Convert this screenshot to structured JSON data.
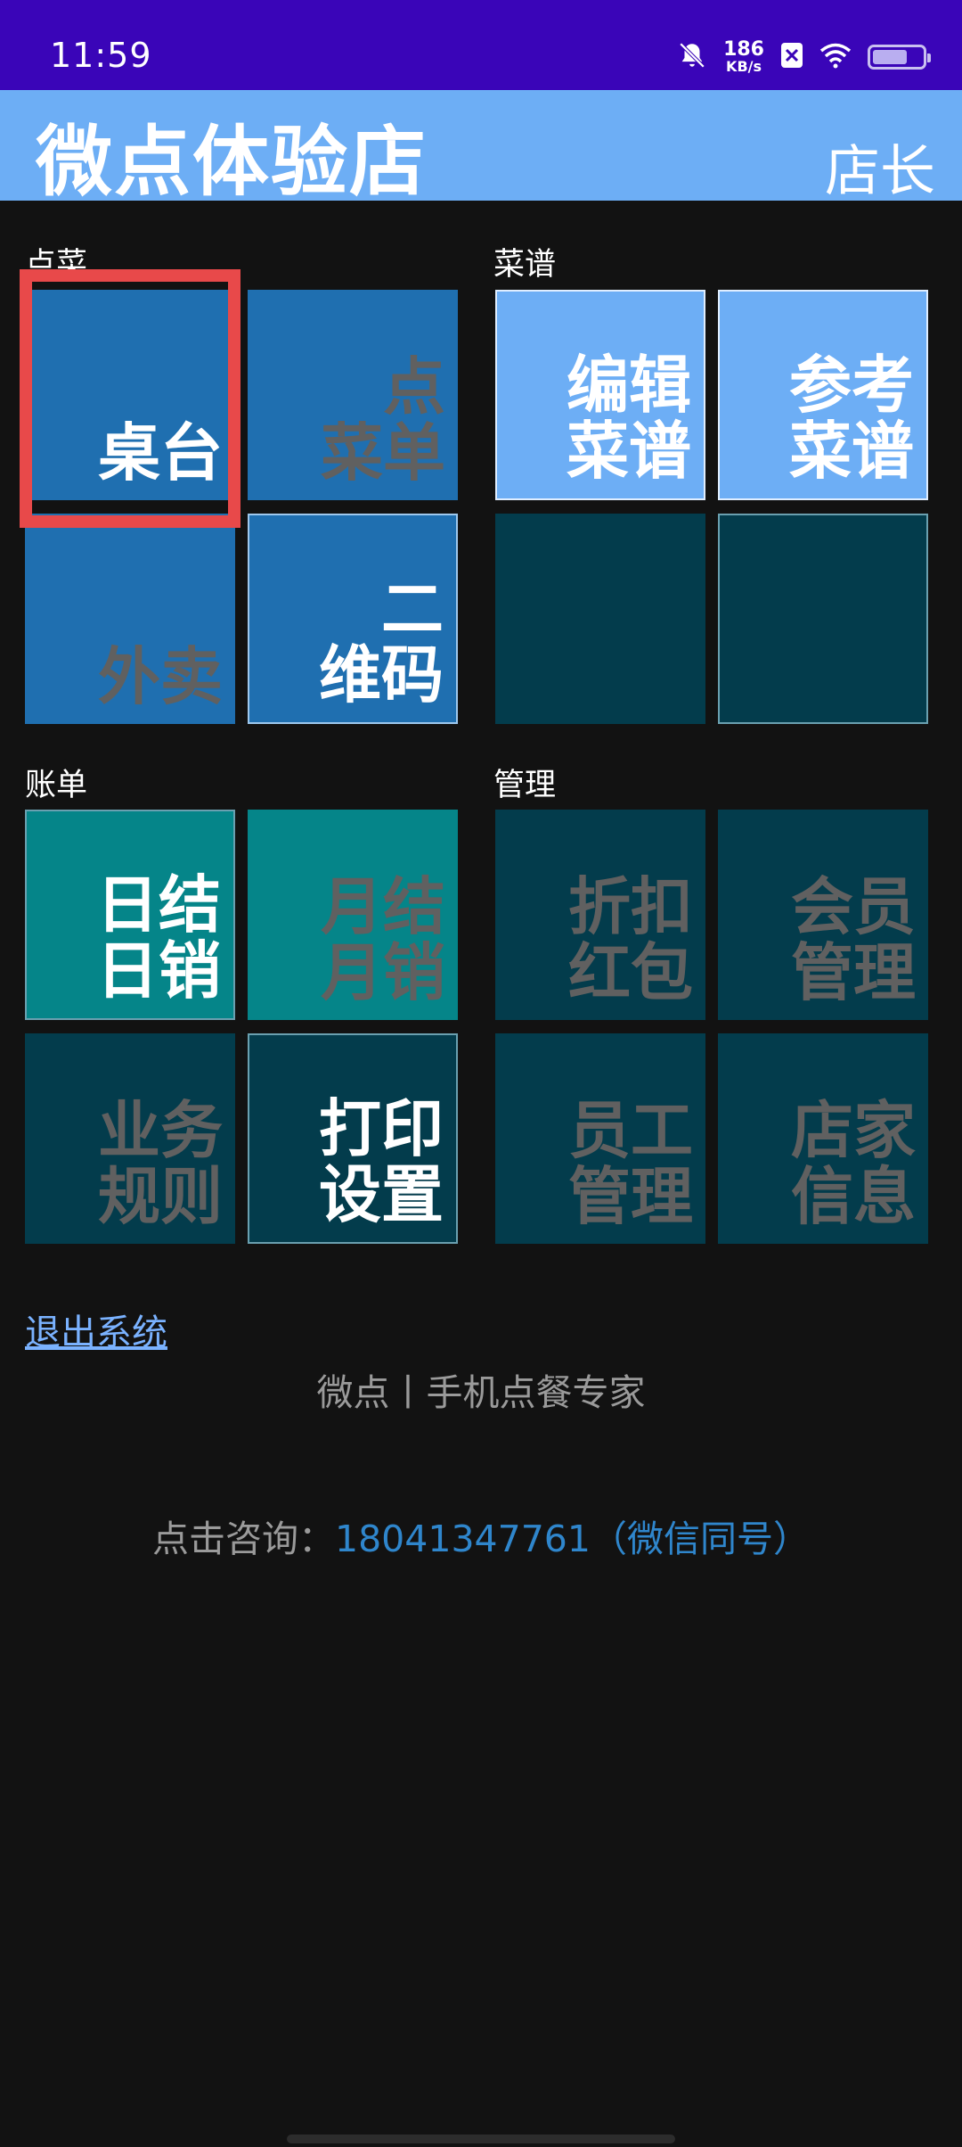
{
  "status_bar": {
    "time": "11:59",
    "net_speed_value": "186",
    "net_speed_unit": "KB/s",
    "battery_level": 0.7
  },
  "header": {
    "shop_name": "微点体验店",
    "role": "店长"
  },
  "sections": {
    "order": "点菜",
    "menu": "菜谱",
    "bill": "账单",
    "manage": "管理"
  },
  "tiles": {
    "table": "桌台",
    "order_list": "点\n菜单",
    "takeout": "外卖",
    "qrcode": "二\n维码",
    "edit_menu": "编辑\n菜谱",
    "ref_menu": "参考\n菜谱",
    "daily_settle": "日结\n日销",
    "monthly_settle": "月结\n月销",
    "business_rules": "业务\n规则",
    "print_settings": "打印\n设置",
    "discount": "折扣\n红包",
    "member": "会员\n管理",
    "staff": "员工\n管理",
    "shop_info": "店家\n信息"
  },
  "footer": {
    "logout": "退出系统",
    "slogan": "微点丨手机点餐专家",
    "consult_prefix": "点击咨询：",
    "consult_phone": "18041347761（微信同号）"
  },
  "colors": {
    "status_bar": "#3a05b8",
    "header": "#6daef5",
    "tile_blue": "#1f6fb0",
    "tile_light": "#6daef5",
    "tile_teal": "#058589",
    "tile_dark": "#033c4c",
    "highlight": "#e8494a",
    "link": "#7ab2ff"
  }
}
